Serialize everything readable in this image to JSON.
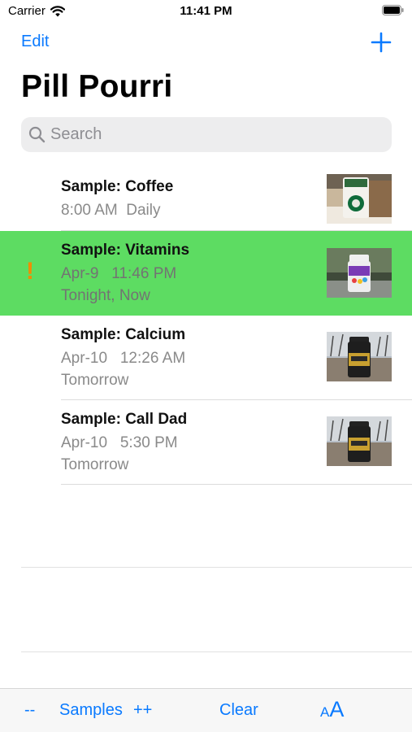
{
  "status_bar": {
    "carrier": "Carrier",
    "time": "11:41 PM"
  },
  "nav": {
    "edit_label": "Edit",
    "add_icon": "plus-icon"
  },
  "title": "Pill Pourri",
  "search": {
    "placeholder": "Search",
    "value": ""
  },
  "items": [
    {
      "title": "Sample: Coffee",
      "line1": "8:00 AM  Daily",
      "line2": "",
      "highlighted": false,
      "alert": "",
      "thumbnail": "coffee-cup-photo"
    },
    {
      "title": "Sample: Vitamins",
      "line1": "Apr-9   11:46 PM",
      "line2": "Tonight, Now",
      "highlighted": true,
      "alert": "!",
      "thumbnail": "vitamin-bottle-photo"
    },
    {
      "title": "Sample: Calcium",
      "line1": "Apr-10   12:26 AM",
      "line2": "Tomorrow",
      "highlighted": false,
      "alert": "",
      "thumbnail": "supplement-bottle-photo"
    },
    {
      "title": "Sample: Call Dad",
      "line1": "Apr-10   5:30 PM",
      "line2": "Tomorrow",
      "highlighted": false,
      "alert": "",
      "thumbnail": "supplement-bottle-photo"
    }
  ],
  "toolbar": {
    "minus_label": "--",
    "samples_label": "Samples",
    "plus_label": "++",
    "clear_label": "Clear",
    "font_small": "A",
    "font_big": "A"
  },
  "colors": {
    "accent": "#0a7aff",
    "highlight": "#5ddc62",
    "alert": "#f28c00"
  }
}
